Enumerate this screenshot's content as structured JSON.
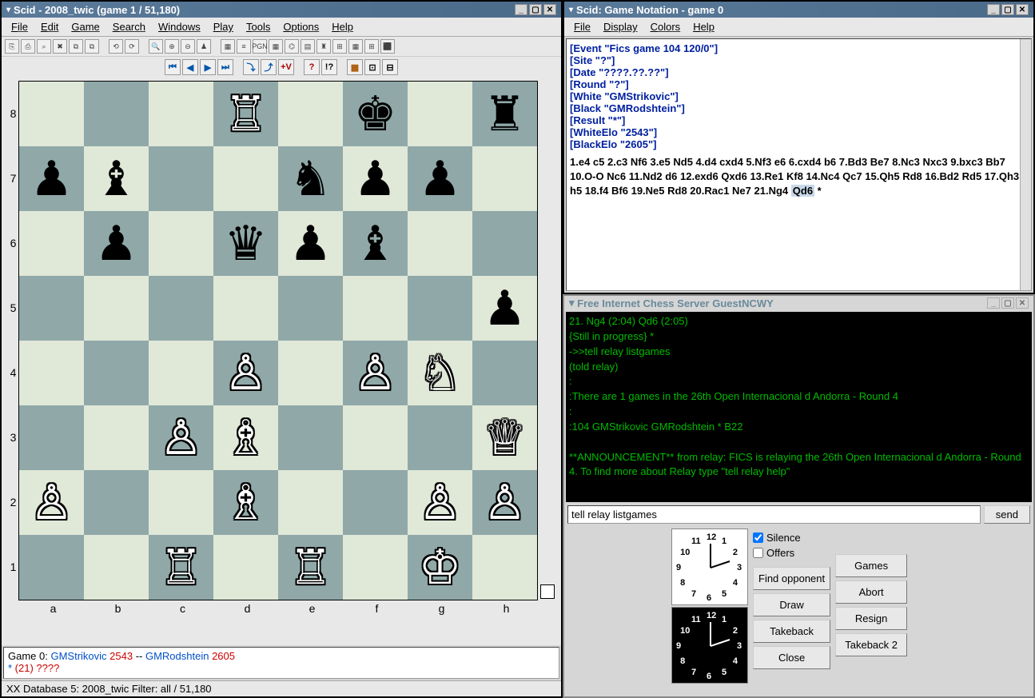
{
  "main": {
    "title": "Scid - 2008_twic (game 1 / 51,180)",
    "menu": [
      "File",
      "Edit",
      "Game",
      "Search",
      "Windows",
      "Play",
      "Tools",
      "Options",
      "Help"
    ],
    "board": {
      "files": [
        "a",
        "b",
        "c",
        "d",
        "e",
        "f",
        "g",
        "h"
      ],
      "ranks": [
        "8",
        "7",
        "6",
        "5",
        "4",
        "3",
        "2",
        "1"
      ],
      "position": [
        [
          "",
          "",
          "",
          "wR",
          "",
          "bK",
          "",
          "bR"
        ],
        [
          "bP",
          "bB",
          "",
          "",
          "bN",
          "bP",
          "bP",
          ""
        ],
        [
          "",
          "bP",
          "",
          "bQ",
          "bP",
          "bB",
          "",
          ""
        ],
        [
          "",
          "",
          "",
          "",
          "",
          "",
          "",
          "bP"
        ],
        [
          "",
          "",
          "",
          "wP",
          "",
          "wP",
          "wN",
          ""
        ],
        [
          "",
          "",
          "wP",
          "wB",
          "",
          "",
          "",
          "wQ"
        ],
        [
          "wP",
          "",
          "",
          "wB",
          "",
          "",
          "wP",
          "wP"
        ],
        [
          "",
          "",
          "wR",
          "",
          "wR",
          "",
          "wK",
          ""
        ]
      ]
    },
    "game_info": {
      "prefix": "Game 0:  ",
      "white": "GMStrikovic",
      "white_elo": "2543",
      "sep": "  --  ",
      "black": "GMRodshtein",
      "black_elo": "2605",
      "line2a": "*",
      "line2b": " (21)   ",
      "line2c": "????"
    },
    "status": "  XX  Database 5: 2008_twic    Filter: all / 51,180"
  },
  "notation": {
    "title": "Scid: Game Notation - game 0",
    "menu": [
      "File",
      "Display",
      "Colors",
      "Help"
    ],
    "headers": [
      "[Event \"Fics game 104 120/0\"]",
      "[Site \"?\"]",
      "[Date \"????.??.??\"]",
      "[Round \"?\"]",
      "[White \"GMStrikovic\"]",
      "[Black \"GMRodshtein\"]",
      "[Result \"*\"]",
      "[WhiteElo \"2543\"]",
      "[BlackElo \"2605\"]"
    ],
    "moves": "1.e4 c5 2.c3 Nf6 3.e5 Nd5 4.d4 cxd4 5.Nf3 e6 6.cxd4 b6 7.Bd3 Be7 8.Nc3 Nxc3 9.bxc3 Bb7 10.O-O Nc6 11.Nd2 d6 12.exd6 Qxd6 13.Re1 Kf8 14.Nc4 Qc7 15.Qh5 Rd8 16.Bd2 Rd5 17.Qh3 h5 18.f4 Bf6 19.Ne5 Rd8 20.Rac1 Ne7 21.Ng4 ",
    "highlight": "Qd6",
    "after": " *"
  },
  "fics": {
    "title": "Free Internet Chess Server GuestNCWY",
    "lines": [
      "21.  Ng4     (2:04)     Qd6     (2:05)",
      "      {Still in progress} *",
      "->>tell relay listgames",
      "(told relay)",
      ":",
      ":There are 1 games in the 26th Open Internacional d Andorra - Round 4",
      ":",
      ":104 GMStrikovic       GMRodshtein        *       B22",
      "",
      "    **ANNOUNCEMENT** from relay: FICS is relaying the 26th Open Internacional d Andorra - Round 4. To find more about Relay type \"tell relay help\""
    ],
    "input": "tell relay listgames",
    "send": "send",
    "silence": "Silence",
    "offers": "Offers",
    "buttons": {
      "find": "Find opponent",
      "games": "Games",
      "draw": "Draw",
      "abort": "Abort",
      "takeback": "Takeback",
      "resign": "Resign",
      "close": "Close",
      "takeback2": "Takeback 2"
    }
  }
}
